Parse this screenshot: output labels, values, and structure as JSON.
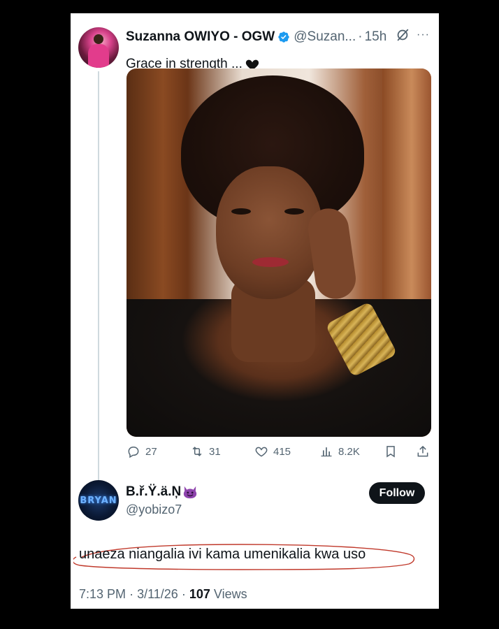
{
  "tweet": {
    "author_name": "Suzanna OWIYO - OGW",
    "handle": "@Suzan...",
    "separator": "·",
    "time": "15h",
    "text": "Grace in strength ...",
    "emoji_icon": "black-heart-icon",
    "more_label": "···"
  },
  "actions": {
    "replies": "27",
    "reposts": "31",
    "likes": "415",
    "views": "8.2K"
  },
  "reply": {
    "author_name": "B.ř.Ÿ.ä.Ņ",
    "emoji_icon": "smiling-devil-icon",
    "handle": "@yobizo7",
    "avatar_text": "BRYAN",
    "follow_label": "Follow",
    "text": "unaeza niangalia ivi kama umenikalia kwa uso",
    "time": "7:13 PM",
    "sep": "·",
    "date": "3/11/26",
    "sep2": "·",
    "views_count": "107",
    "views_label": "Views"
  },
  "colors": {
    "background": "#000000",
    "card": "#ffffff",
    "text": "#0f1419",
    "muted": "#536471",
    "verified": "#1d9bf0",
    "annotation": "#c0392b"
  }
}
